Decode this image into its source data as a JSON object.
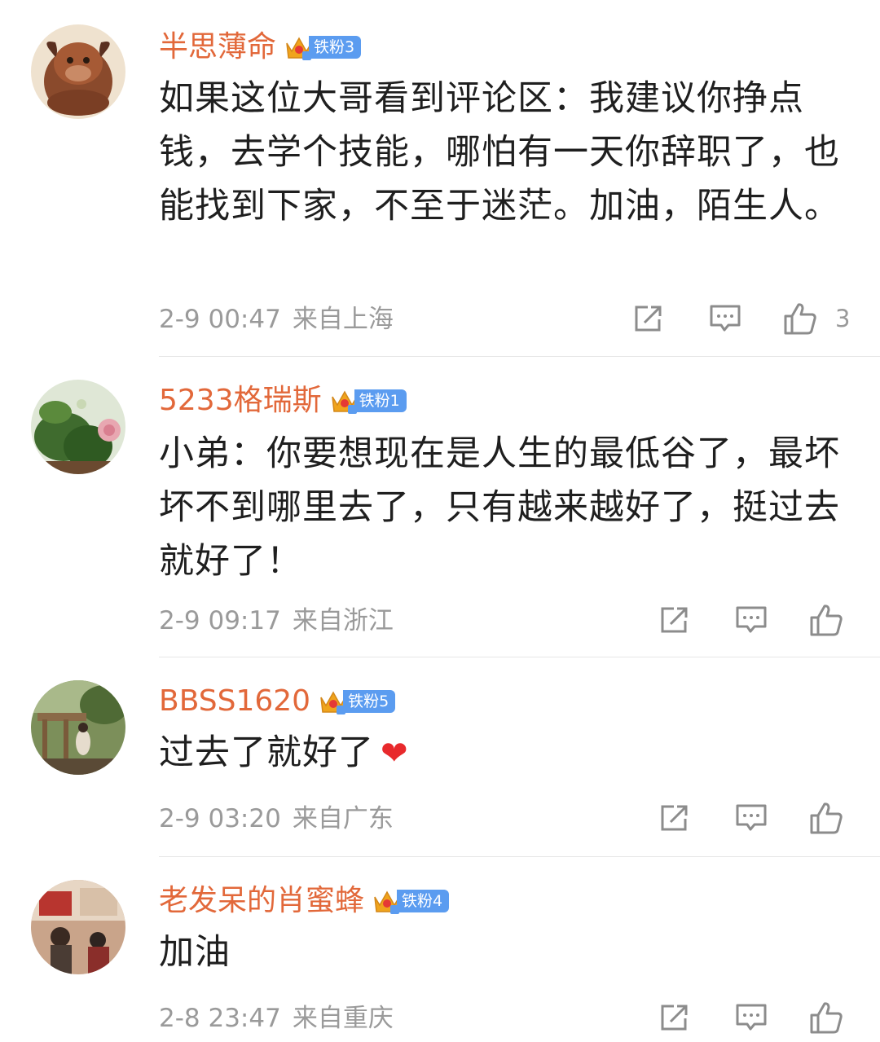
{
  "comments": [
    {
      "username": "半思薄命",
      "badge": "铁粉3",
      "content": "如果这位大哥看到评论区：我建议你挣点钱，去学个技能，哪怕有一天你辞职了，也能找到下家，不至于迷茫。加油，陌生人。",
      "time": "2-9 00:47",
      "location": "来自上海",
      "likes": "3"
    },
    {
      "username": "5233格瑞斯",
      "badge": "铁粉1",
      "content": "小弟：你要想现在是人生的最低谷了，最坏坏不到哪里去了，只有越来越好了，挺过去就好了！",
      "time": "2-9 09:17",
      "location": "来自浙江",
      "likes": ""
    },
    {
      "username": "BBSS1620",
      "badge": "铁粉5",
      "content": "过去了就好了",
      "emoji": "❤",
      "time": "2-9 03:20",
      "location": "来自广东",
      "likes": ""
    },
    {
      "username": "老发呆的肖蜜蜂",
      "badge": "铁粉4",
      "content": "加油",
      "time": "2-8 23:47",
      "location": "来自重庆",
      "likes": ""
    }
  ],
  "icons": {
    "repost": "repost-icon",
    "comment": "comment-icon",
    "like": "like-icon",
    "crown": "crown-icon"
  },
  "colors": {
    "username": "#e2683a",
    "badge": "#5b9cf0",
    "meta": "#9a9a9a"
  }
}
